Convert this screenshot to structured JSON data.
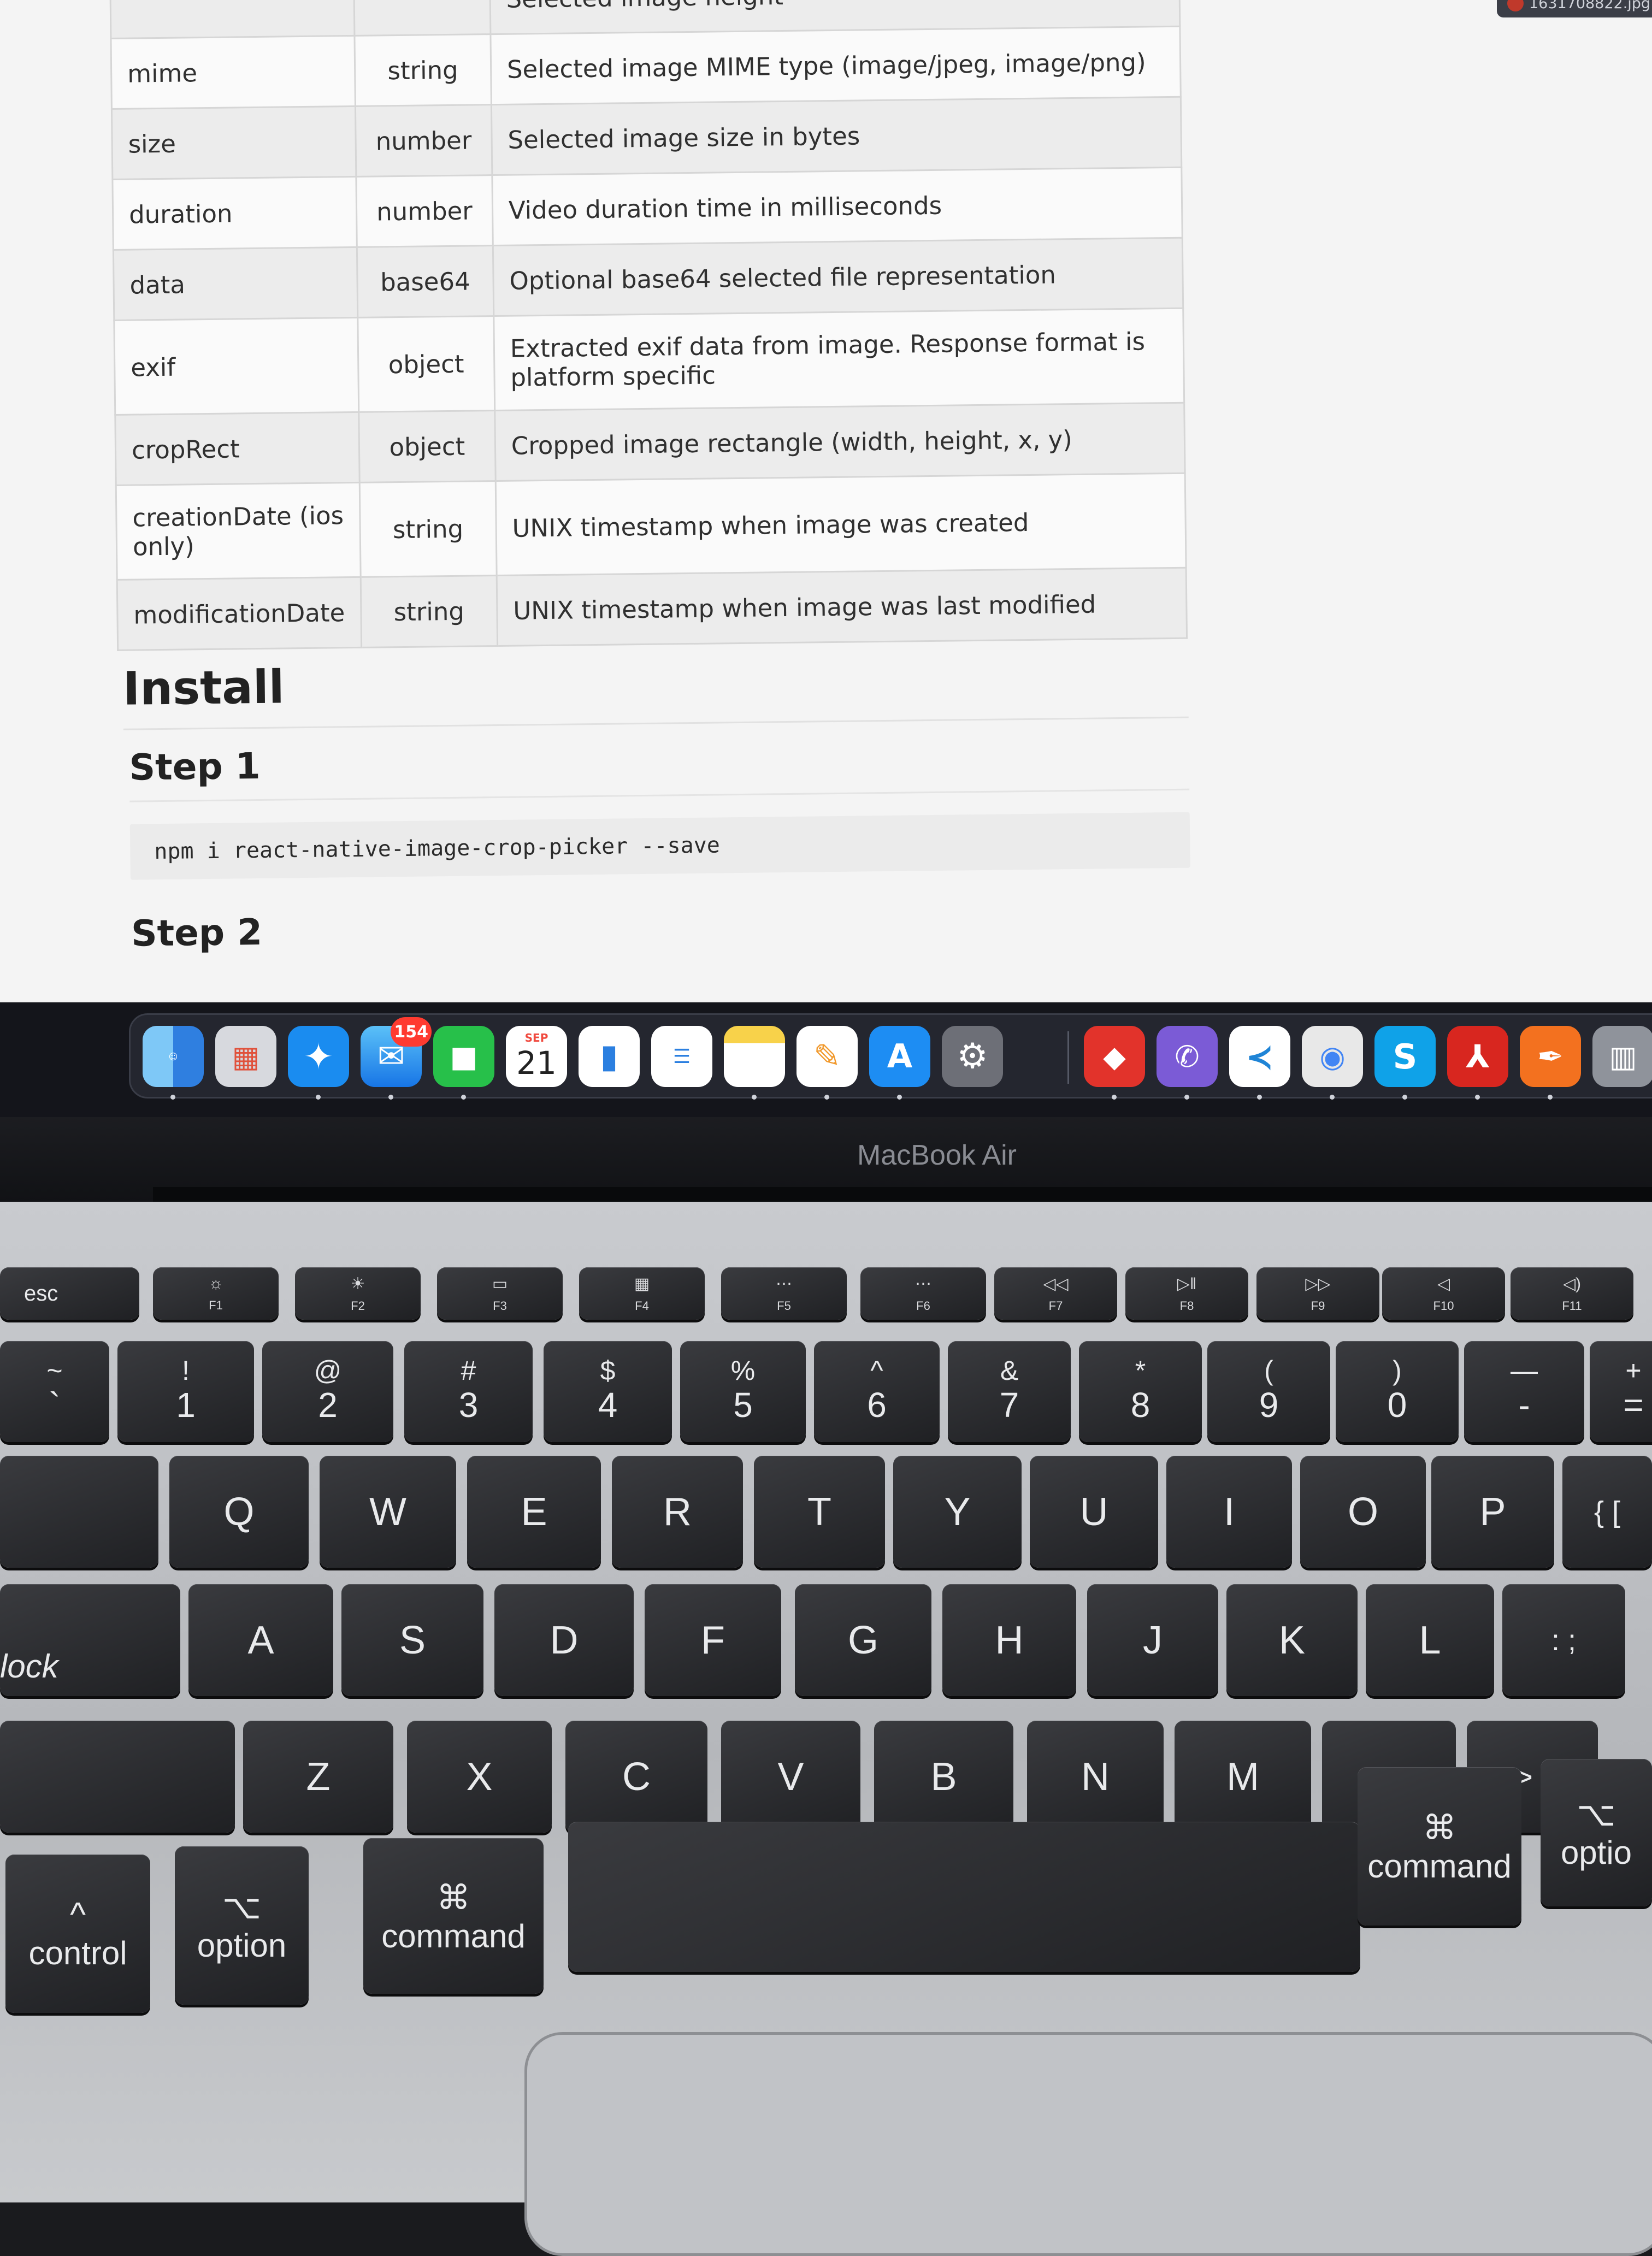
{
  "browser": {
    "tab_filename": "1631708822.jpg"
  },
  "doc": {
    "rows": [
      {
        "name": "",
        "type": "",
        "description": "Selected image height"
      },
      {
        "name": "mime",
        "type": "string",
        "description": "Selected image MIME type (image/jpeg, image/png)"
      },
      {
        "name": "size",
        "type": "number",
        "description": "Selected image size in bytes"
      },
      {
        "name": "duration",
        "type": "number",
        "description": "Video duration time in milliseconds"
      },
      {
        "name": "data",
        "type": "base64",
        "description": "Optional base64 selected file representation"
      },
      {
        "name": "exif",
        "type": "object",
        "description": "Extracted exif data from image. Response format is platform specific"
      },
      {
        "name": "cropRect",
        "type": "object",
        "description": "Cropped image rectangle (width, height, x, y)"
      },
      {
        "name": "creationDate (ios only)",
        "type": "string",
        "description": "UNIX timestamp when image was created"
      },
      {
        "name": "modificationDate",
        "type": "string",
        "description": "UNIX timestamp when image was last modified"
      }
    ],
    "install_heading": "Install",
    "step1_heading": "Step 1",
    "step1_code": "npm i react-native-image-crop-picker --save",
    "step2_heading": "Step 2"
  },
  "dock": {
    "mail_badge": "154",
    "calendar_month": "SEP",
    "calendar_day": "21",
    "icons": [
      "finder-icon",
      "launchpad-icon",
      "safari-icon",
      "mail-icon",
      "facetime-icon",
      "calendar-icon",
      "keynote-icon",
      "reminders-icon",
      "notes-icon",
      "pages-icon",
      "app-store-icon",
      "system-preferences-icon",
      "anydesk-icon",
      "viber-icon",
      "vscode-icon",
      "chrome-icon",
      "skype-icon",
      "acrobat-icon",
      "pen-app-icon",
      "trash-icon"
    ]
  },
  "device": {
    "model_label": "MacBook Air"
  },
  "keyboard": {
    "esc": "esc",
    "fkeys": [
      {
        "icon": "☼",
        "label": "F1"
      },
      {
        "icon": "☀",
        "label": "F2"
      },
      {
        "icon": "▭",
        "label": "F3"
      },
      {
        "icon": "▦",
        "label": "F4"
      },
      {
        "icon": "⋯",
        "label": "F5"
      },
      {
        "icon": "⋯",
        "label": "F6"
      },
      {
        "icon": "◁◁",
        "label": "F7"
      },
      {
        "icon": "▷‖",
        "label": "F8"
      },
      {
        "icon": "▷▷",
        "label": "F9"
      },
      {
        "icon": "◁",
        "label": "F10"
      },
      {
        "icon": "◁)",
        "label": "F11"
      }
    ],
    "number_row": [
      {
        "top": "~",
        "bot": "`"
      },
      {
        "top": "!",
        "bot": "1"
      },
      {
        "top": "@",
        "bot": "2"
      },
      {
        "top": "#",
        "bot": "3"
      },
      {
        "top": "$",
        "bot": "4"
      },
      {
        "top": "%",
        "bot": "5"
      },
      {
        "top": "^",
        "bot": "6"
      },
      {
        "top": "&",
        "bot": "7"
      },
      {
        "top": "*",
        "bot": "8"
      },
      {
        "top": "(",
        "bot": "9"
      },
      {
        "top": ")",
        "bot": "0"
      },
      {
        "top": "—",
        "bot": "-"
      },
      {
        "top": "+",
        "bot": "="
      }
    ],
    "qwerty_row": [
      "Q",
      "W",
      "E",
      "R",
      "T",
      "Y",
      "U",
      "I",
      "O",
      "P",
      "{ ["
    ],
    "home_row": [
      "A",
      "S",
      "D",
      "F",
      "G",
      "H",
      "J",
      "K",
      "L",
      ": ;"
    ],
    "caps_label": "lock",
    "bottom_row": [
      "Z",
      "X",
      "C",
      "V",
      "B",
      "N",
      "M",
      "< ,",
      "> ."
    ],
    "control_label": "control",
    "control_symbol": "^",
    "option_label": "option",
    "option_symbol": "⌥",
    "command_label": "command",
    "command_symbol": "⌘",
    "right_command_label": "command",
    "right_option_label": "optio"
  }
}
